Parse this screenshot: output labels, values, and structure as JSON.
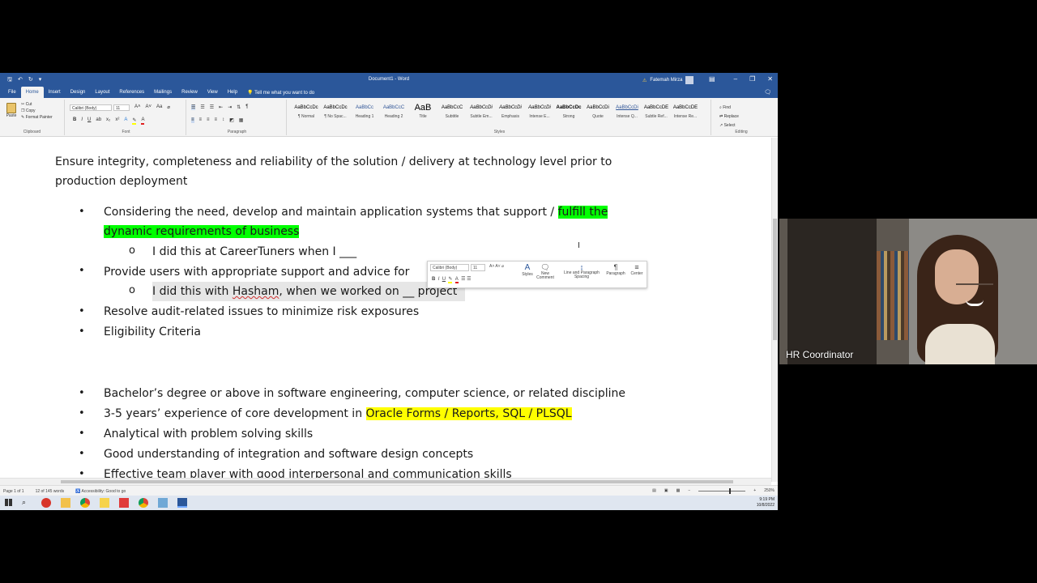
{
  "window": {
    "doc_title": "Document1 - Word",
    "user_name": "Fatemah Mirza"
  },
  "menu": {
    "tabs": [
      "File",
      "Home",
      "Insert",
      "Design",
      "Layout",
      "References",
      "Mailings",
      "Review",
      "View",
      "Help"
    ],
    "active_tab": "Home",
    "tell_me": "Tell me what you want to do"
  },
  "ribbon": {
    "clipboard": {
      "paste": "Paste",
      "cut": "Cut",
      "copy": "Copy",
      "format_painter": "Format Painter",
      "label": "Clipboard"
    },
    "font": {
      "name": "Calibri (Body)",
      "size": "11",
      "label": "Font"
    },
    "paragraph": {
      "label": "Paragraph"
    },
    "styles": {
      "label": "Styles",
      "items": [
        {
          "sample": "AaBbCcDc",
          "name": "¶ Normal"
        },
        {
          "sample": "AaBbCcDc",
          "name": "¶ No Spac..."
        },
        {
          "sample": "AaBbCc",
          "name": "Heading 1"
        },
        {
          "sample": "AaBbCcC",
          "name": "Heading 2"
        },
        {
          "sample": "AaB",
          "name": "Title"
        },
        {
          "sample": "AaBbCcC",
          "name": "Subtitle"
        },
        {
          "sample": "AaBbCcDi",
          "name": "Subtle Em..."
        },
        {
          "sample": "AaBbCcDi",
          "name": "Emphasis"
        },
        {
          "sample": "AaBbCcDi",
          "name": "Intense E..."
        },
        {
          "sample": "AaBbCcDc",
          "name": "Strong"
        },
        {
          "sample": "AaBbCcDi",
          "name": "Quote"
        },
        {
          "sample": "AaBbCcDi",
          "name": "Intense Q..."
        },
        {
          "sample": "AaBbCcDE",
          "name": "Subtle Ref..."
        },
        {
          "sample": "AaBbCcDE",
          "name": "Intense Re..."
        }
      ]
    },
    "editing": {
      "find": "Find",
      "replace": "Replace",
      "select": "Select",
      "label": "Editing"
    }
  },
  "document": {
    "intro_line1": "Ensure integrity, completeness and reliability of the solution / delivery at technology level prior to",
    "intro_line2": "production deployment",
    "b1_plain": "Considering the need, develop and maintain application systems that support / ",
    "b1_hl_a": "fulfill the",
    "b1_hl_b": "dynamic requirements of business",
    "sub1": "I did this at CareerTuners when I ___",
    "b2": "Provide users with appropriate support and advice for",
    "sub2_a": "I did this with ",
    "sub2_name": "Hasham",
    "sub2_b": ", when we worked on __ project",
    "b3": "Resolve audit-related issues to minimize risk exposures",
    "b4": "Eligibility Criteria",
    "b5": "Bachelor’s degree or above in software engineering, computer science, or related discipline",
    "b6_plain": "3-5 years’ experience of core development in ",
    "b6_hl": "Oracle Forms / Reports, SQL / PLSQL",
    "b7": "Analytical with problem solving skills",
    "b8": "Good understanding of integration and software design concepts",
    "b9": "Effective team player with good interpersonal and communication skills",
    "bullet_char": "•",
    "sub_bullet_char": "o"
  },
  "mini_toolbar": {
    "font": "Calibri (Body)",
    "size": "11",
    "styles": "Styles",
    "new_comment": "New Comment",
    "line_spacing": "Line and Paragraph Spacing",
    "paragraph": "Paragraph",
    "center": "Center"
  },
  "status": {
    "page": "Page 1 of 1",
    "words": "12 of 145 words",
    "accessibility": "Accessibility: Good to go",
    "zoom": "250%"
  },
  "taskbar": {
    "time": "9:19 PM",
    "date": "10/8/2022"
  },
  "video": {
    "caption": "HR Coordinator"
  }
}
